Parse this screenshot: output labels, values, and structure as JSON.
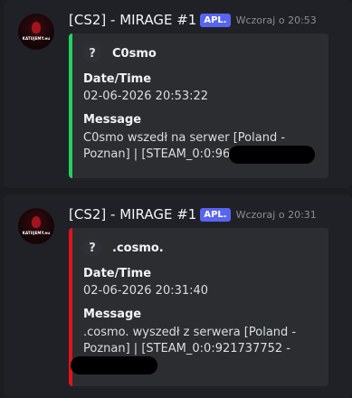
{
  "messages": [
    {
      "avatar_text": "KATUJEMY.eu",
      "author": "[CS2] - MIRAGE #1",
      "badge": "APL.",
      "timestamp": "Wczoraj o 20:53",
      "stripe_color": "#23d160",
      "embed": {
        "icon": "?",
        "author_name": "C0smo",
        "fields": [
          {
            "name": "Date/Time",
            "value": "02-06-2026 20:53:22"
          },
          {
            "name": "Message",
            "value": "C0smo wszedł na serwer [Poland - Poznan] | [STEAM_0:0:960005422 -"
          }
        ]
      }
    },
    {
      "avatar_text": "KATUJEMY.eu",
      "author": "[CS2] - MIRAGE #1",
      "badge": "APL.",
      "timestamp": "Wczoraj o 20:31",
      "stripe_color": "#e0141c",
      "embed": {
        "icon": "?",
        "author_name": ".cosmo.",
        "fields": [
          {
            "name": "Date/Time",
            "value": "02-06-2026 20:31:40"
          },
          {
            "name": "Message",
            "value": ".cosmo. wyszedł z serwera [Poland - Poznan] | [STEAM_0:0:921737752 -"
          }
        ]
      }
    }
  ]
}
